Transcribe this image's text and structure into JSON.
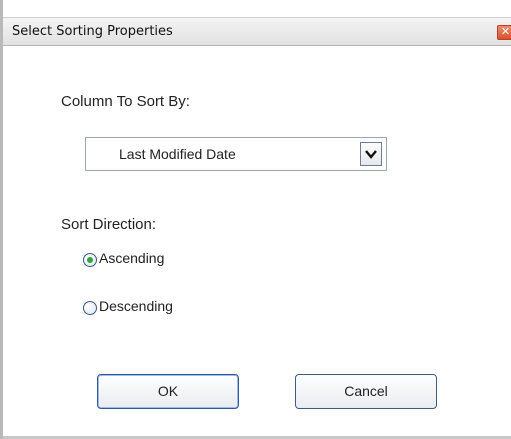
{
  "window": {
    "title": "Select Sorting Properties",
    "close_glyph": "✕"
  },
  "sort_column": {
    "label": "Column To Sort By:",
    "selected": "Last Modified Date",
    "dropdown_icon": "chevron-down-icon"
  },
  "sort_direction": {
    "label": "Sort Direction:",
    "options": [
      {
        "label": "Ascending",
        "checked": true
      },
      {
        "label": "Descending",
        "checked": false
      }
    ]
  },
  "buttons": {
    "ok_label": "OK",
    "cancel_label": "Cancel"
  },
  "colors": {
    "radio_selected": "#2ea63d",
    "close_button": "#d9522e",
    "button_border": "#2c5aa0"
  }
}
